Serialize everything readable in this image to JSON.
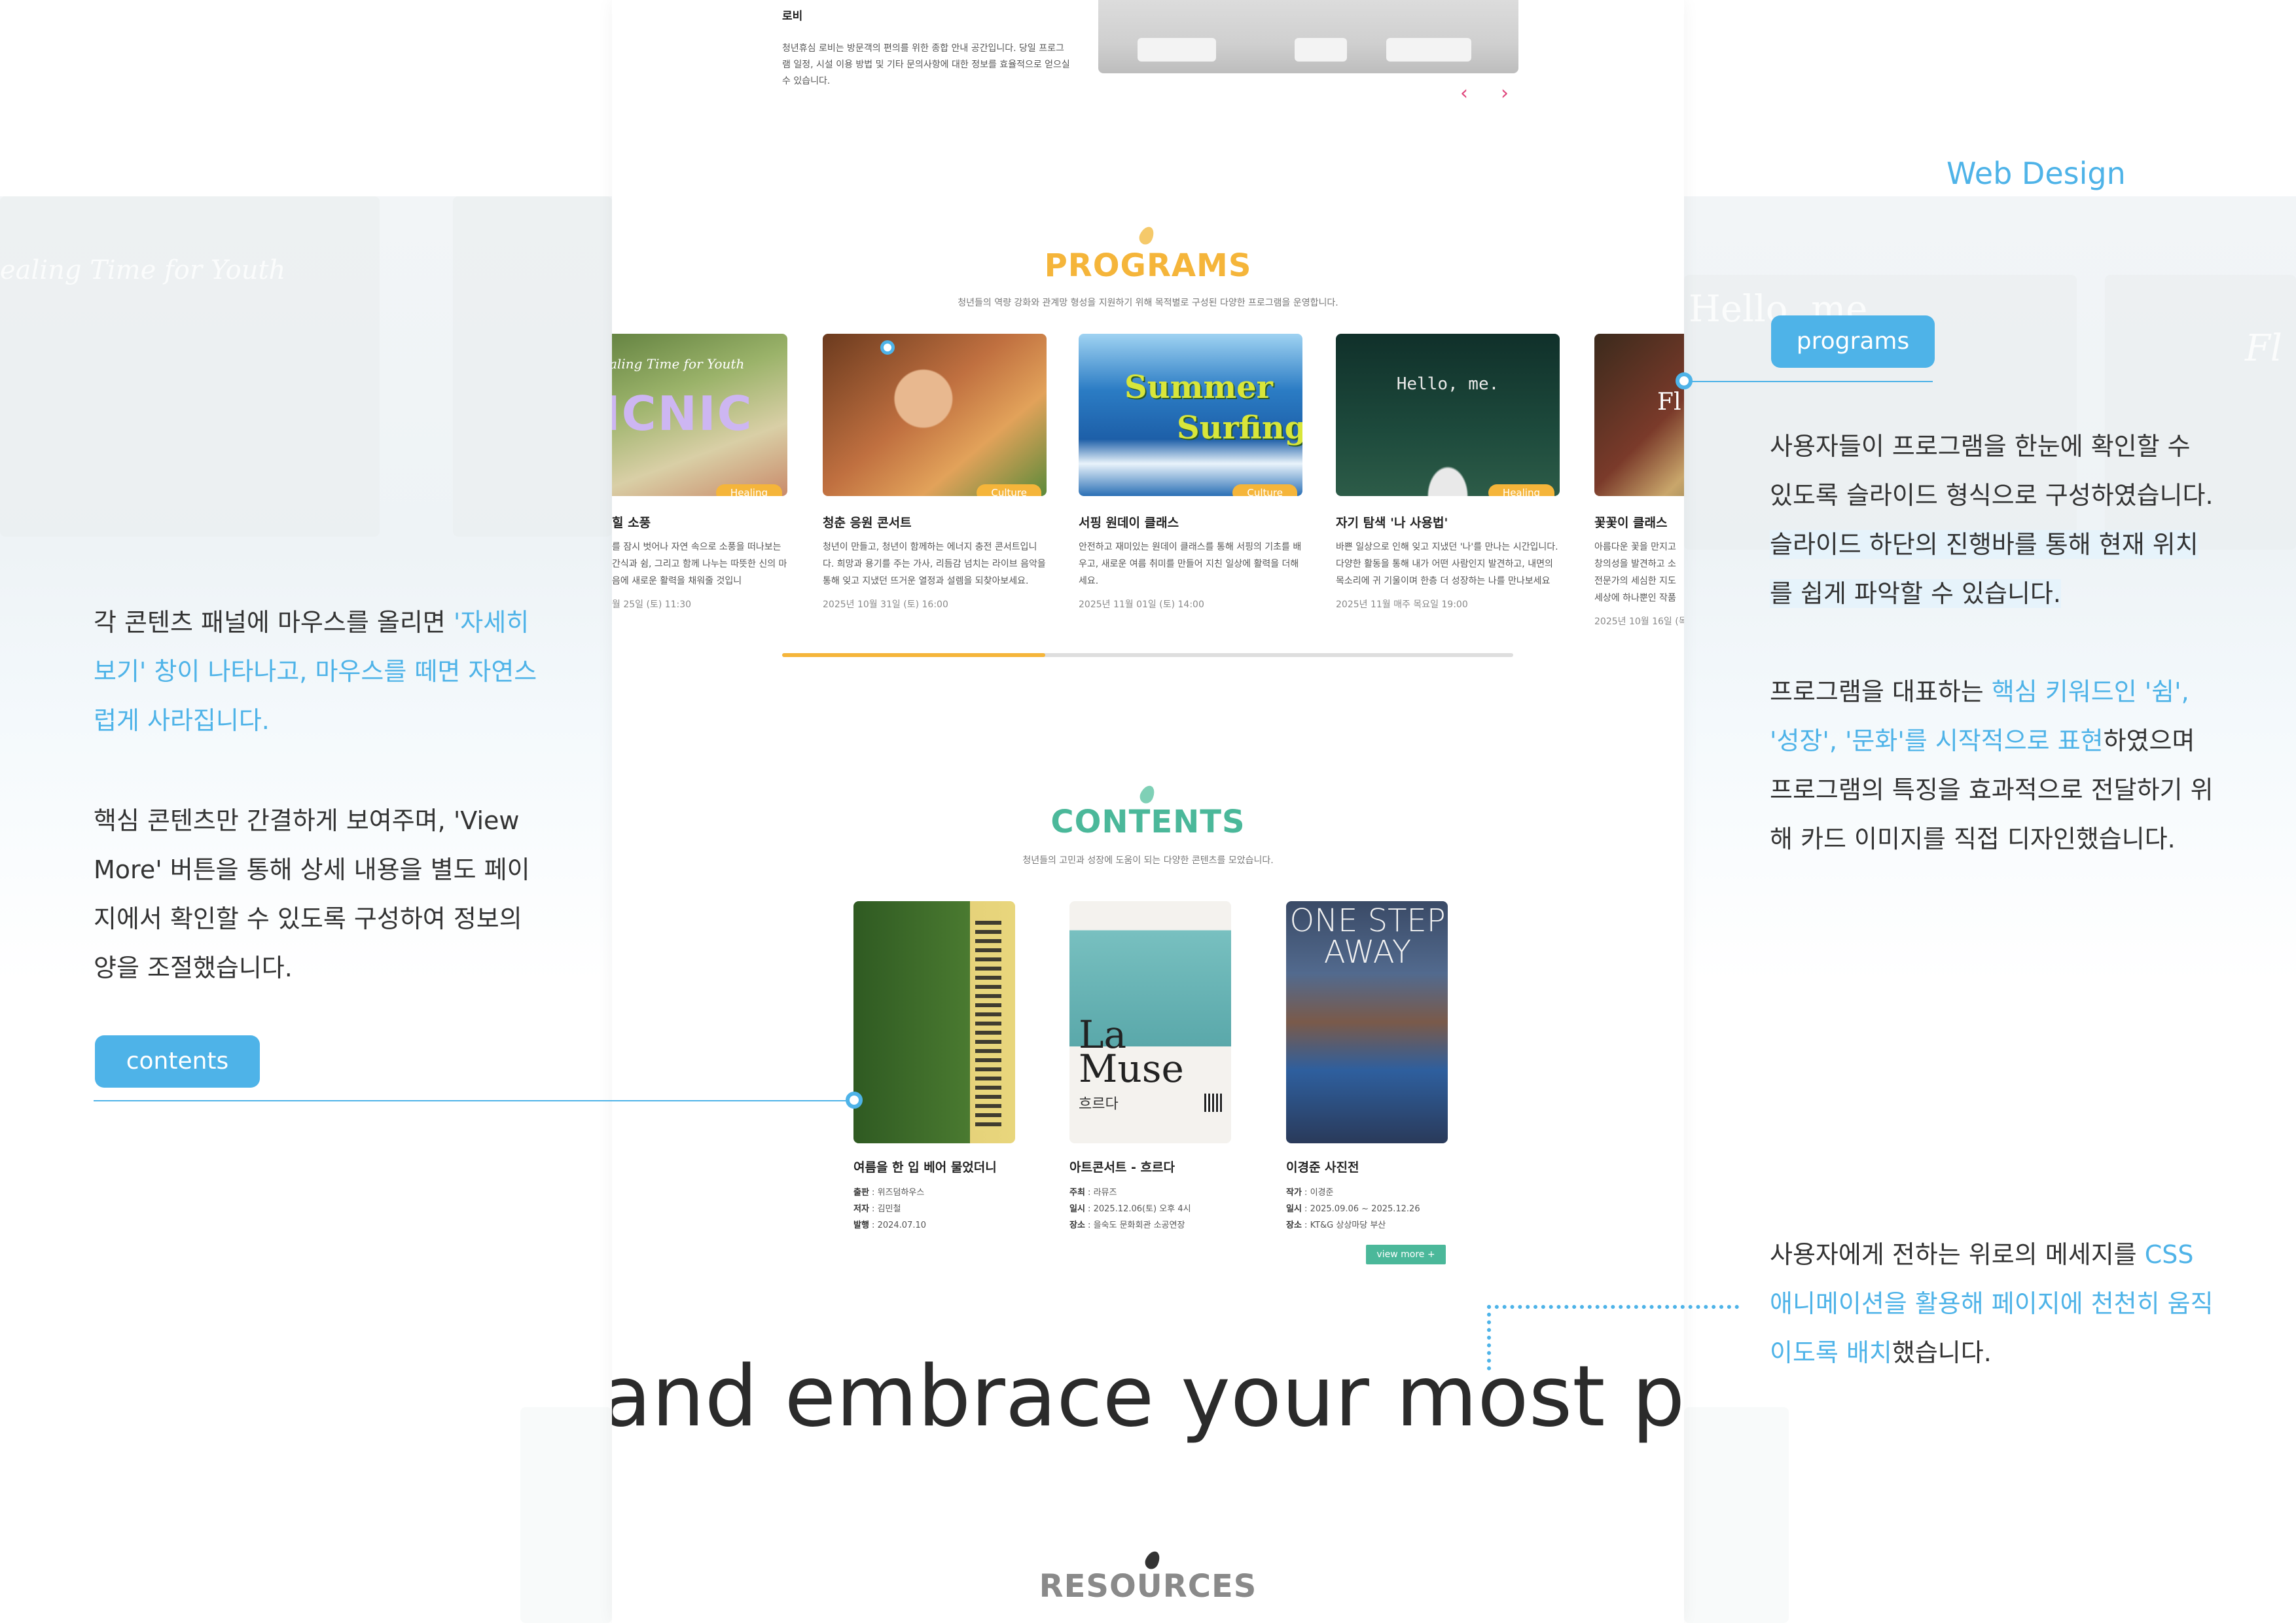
{
  "header": {
    "label": "Web Design"
  },
  "background": {
    "ghost_left_text": "ealing Time for Youth",
    "ghost_right_text_1": "Hello, me",
    "ghost_right_text_2": "Fl"
  },
  "lobby": {
    "title": "로비",
    "description": "청년휴심 로비는 방문객의 편의를 위한 종합 안내 공간입니다. 당일 프로그램 일정, 시설 이용 방법 및 기타 문의사항에 대한 정보를 효율적으로 얻으실 수 있습니다.",
    "prev_arrow": "‹",
    "next_arrow": "›"
  },
  "programs": {
    "title": "PROGRAMS",
    "subtitle": "청년들의 역량 강화와 관계망 형성을 지원하기 위해 목적별로 구성된 다양한 프로그램을 운영합니다.",
    "progress": 0.36,
    "cards": [
      {
        "img_text": "aling Time for Youth",
        "img_big": "ICNIC",
        "badge": "Healing",
        "title": "힐 소풍",
        "desc": "를 잠시 벗어나 자연 속으로 소풍을 떠나보는 간식과 쉼, 그리고 함께 나누는 따뜻한 신의 마음에 새로운 활력을 채워줄 것입니",
        "date": "월 25일 (토) 11:30"
      },
      {
        "img_text": "",
        "img_big": "",
        "badge": "Culture",
        "title": "청춘 응원 콘서트",
        "desc": "청년이 만들고, 청년이 함께하는 에너지 충전 콘서트입니다. 희망과 용기를 주는 가사, 리듬감 넘치는 라이브 음악을 통해 잊고 지냈던 뜨거운 열정과 설렘을 되찾아보세요.",
        "date": "2025년 10월 31일 (토) 16:00"
      },
      {
        "img_text": "Summer",
        "img_big": "Surfing",
        "badge": "Culture",
        "title": "서핑 원데이 클래스",
        "desc": "안전하고 재미있는 원데이 클래스를 통해 서핑의 기초를 배우고, 새로운 여름 취미를 만들어 지친 일상에 활력을 더해세요.",
        "date": "2025년 11월 01일 (토) 14:00"
      },
      {
        "img_text": "Hello, me.",
        "img_big": "",
        "badge": "Healing",
        "title": "자기 탐색 '나 사용법'",
        "desc": "바쁜 일상으로 인해 잊고 지냈던 '나'를 만나는 시간입니다. 다양한 활동을 통해 내가 어떤 사람인지 발견하고, 내면의 목소리에 귀 기울이며 한층 더 성장하는 나를 만나보세요",
        "date": "2025년 11월 매주 목요일 19:00"
      },
      {
        "img_text": "Fl",
        "img_big": "",
        "badge": "",
        "title": "꽃꽃이 클래스",
        "desc": "아름다운 꽃을 만지고 창의성을 발견하고 소 전문가의 세심한 지도 세상에 하나뿐인 작품",
        "date": "2025년 10월 16일 (목"
      }
    ]
  },
  "contents": {
    "title": "CONTENTS",
    "subtitle": "청년들의 고민과 성장에 도움이 되는 다양한 콘텐츠를 모았습니다.",
    "view_more": "view more +",
    "items": [
      {
        "title": "여름을 한 입 베어 물었더니",
        "meta": [
          {
            "k": "출판",
            "v": "위즈덤하우스"
          },
          {
            "k": "저자",
            "v": "김민철"
          },
          {
            "k": "발행",
            "v": "2024.07.10"
          }
        ]
      },
      {
        "title": "아트콘서트 - 흐르다",
        "img_big": "La Muse",
        "img_sub": "흐르다",
        "meta": [
          {
            "k": "주최",
            "v": "라뮤즈"
          },
          {
            "k": "일시",
            "v": "2025.12.06(토) 오후 4시"
          },
          {
            "k": "장소",
            "v": "을숙도 문화회관 소공연장"
          }
        ]
      },
      {
        "title": "이경준 사진전",
        "img_big": "ONE STEP AWAY",
        "meta": [
          {
            "k": "작가",
            "v": "이경준"
          },
          {
            "k": "일시",
            "v": "2025.09.06 ~ 2025.12.26"
          },
          {
            "k": "장소",
            "v": "KT&G 상상마당 부산"
          }
        ]
      }
    ]
  },
  "marquee": {
    "text": "nt and embrace your most pre"
  },
  "resources": {
    "title": "RESOURCES"
  },
  "annotations": {
    "left": {
      "p1_a": "각 콘텐츠 패널에 마우스를 올리면 ",
      "p1_hl": "'자세히 보기' 창이 나타나고, 마우스를 떼면 자연스럽게 사라집니다.",
      "p2": "핵심 콘텐츠만 간결하게 보여주며, 'View More' 버튼을 통해 상세 내용을 별도 페이지에서 확인할 수 있도록 구성하여 정보의 양을 조절했습니다.",
      "pill": "contents"
    },
    "right": {
      "pill": "programs",
      "p1_a": "사용자들이 프로그램을 한눈에 확인할 수 있도록 슬라이드 형식으로 구성하였습니다. ",
      "p1_hl": "슬라이드 하단의 진행바를 통해 현재 위치를 쉽게 파악할 수 있습니다.",
      "p2_a": "프로그램을 대표하는 ",
      "p2_hl": "핵심 키워드인 '쉼', '성장', '문화'를 시작적으로 표현",
      "p2_b": "하였으며 프로그램의 특징을 효과적으로 전달하기 위해 카드 이미지를 직접 디자인했습니다.",
      "p3_a": "사용자에게 전하는 위로의 메세지를 ",
      "p3_hl": "CSS 애니메이션을 활용해 페이지에 천천히 움직이도록 배치",
      "p3_b": "했습니다."
    }
  },
  "colors": {
    "accent": "#4eb3e8",
    "programs": "#f5b53a",
    "contents": "#4bb89a",
    "resources": "#8a8a8a"
  }
}
